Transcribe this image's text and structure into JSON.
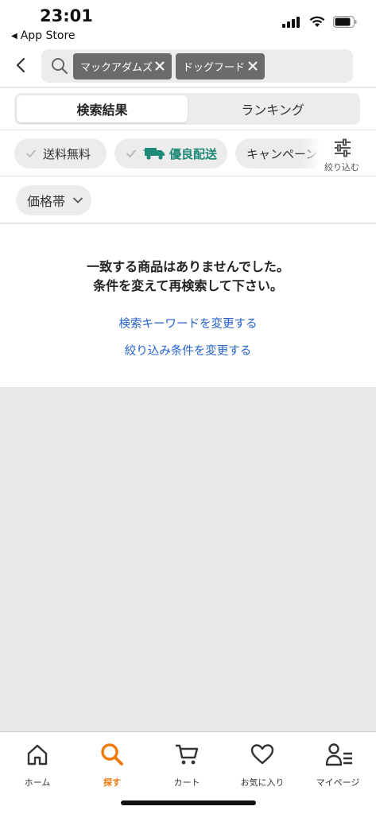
{
  "status": {
    "time": "23:01",
    "back_app": "App Store"
  },
  "search": {
    "chips": [
      "マックアダムズ",
      "ドッグフード"
    ]
  },
  "tabs": [
    {
      "label": "検索結果",
      "active": true
    },
    {
      "label": "ランキング",
      "active": false
    }
  ],
  "filters": {
    "free_shipping": "送料無料",
    "priority_delivery": "優良配送",
    "campaign": "キャンペーン",
    "refine_label": "絞り込む"
  },
  "price_filter": {
    "label": "価格帯"
  },
  "empty_state": {
    "line1": "一致する商品はありませんでした。",
    "line2": "条件を変えて再検索して下さい。",
    "link_keyword": "検索キーワードを変更する",
    "link_filter": "絞り込み条件を変更する"
  },
  "tabbar": [
    {
      "icon": "home-icon",
      "label": "ホーム",
      "active": false
    },
    {
      "icon": "search-icon",
      "label": "探す",
      "active": true
    },
    {
      "icon": "cart-icon",
      "label": "カート",
      "active": false
    },
    {
      "icon": "heart-icon",
      "label": "お気に入り",
      "active": false
    },
    {
      "icon": "user-icon",
      "label": "マイページ",
      "active": false
    }
  ],
  "colors": {
    "accent": "#ef7b0f",
    "link": "#2461c9",
    "delivery": "#1f8a78"
  }
}
